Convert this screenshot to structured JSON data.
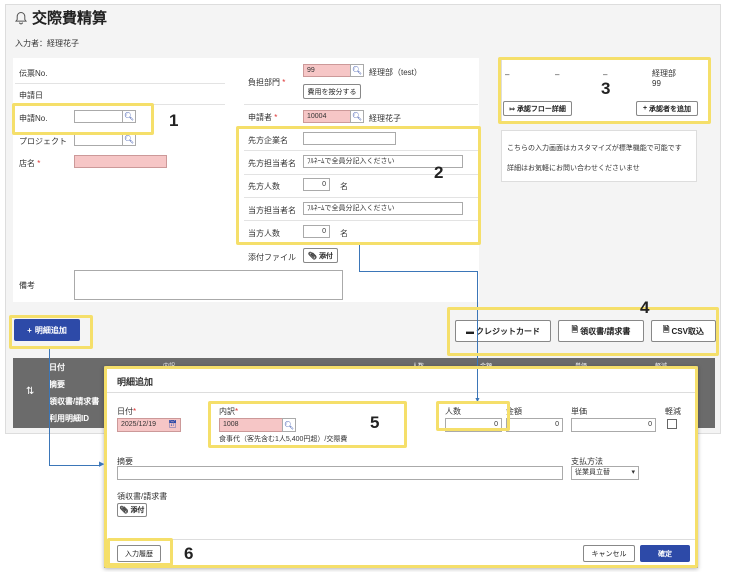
{
  "page": {
    "title": "交際費精算",
    "inputter": "入力者：経理花子"
  },
  "form": {
    "slip_no_label": "伝票No.",
    "apply_date_label": "申請日",
    "apply_no_label": "申請No.",
    "project_label": "プロジェクト",
    "store_label": "店名",
    "required_mark": "*",
    "dept_label": "負担部門",
    "dept_code": "99",
    "dept_name": "経理部（test）",
    "split_cost_button": "費用を按分する",
    "applicant_label": "申請者",
    "applicant_code": "10004",
    "applicant_name": "経理花子",
    "partner_company_label": "先方企業名",
    "partner_person_label": "先方担当者名",
    "partner_person_value": "ﾌﾙﾈｰﾑで全員分記入ください",
    "partner_count_label": "先方人数",
    "partner_count_value": "0",
    "our_person_label": "当方担当者名",
    "our_person_value": "ﾌﾙﾈｰﾑで全員分記入ください",
    "our_count_label": "当方人数",
    "our_count_value": "0",
    "count_unit": "名",
    "attach_label": "添付ファイル",
    "attach_button": "添付",
    "remarks_label": "備考"
  },
  "approval": {
    "dash1": "–",
    "dash2": "–",
    "dash3": "–",
    "dept": "経理部",
    "code": "99",
    "flow_button": "承認フロー詳細",
    "add_approver_button": "承認者を追加"
  },
  "note": {
    "line1": "こちらの入力画面はカスタマイズが標準機能で可能です",
    "line2": "詳細はお気軽にお問い合わせくださいませ"
  },
  "actions": {
    "add_detail": "明細追加",
    "credit_card": "クレジットカード",
    "receipt": "領収書/請求書",
    "csv": "CSV取込"
  },
  "table": {
    "col_date": "日付",
    "col_summary": "摘要",
    "col_receipt": "領収書/請求書",
    "col_usage_id": "利用明細ID",
    "col_breakdown": "内訳",
    "col_people": "人数",
    "col_amount": "金額",
    "col_unit": "単価",
    "col_reduced": "軽減"
  },
  "modal": {
    "title": "明細追加",
    "date_label": "日付",
    "date_value": "2025/12/19",
    "breakdown_label": "内訳",
    "breakdown_code": "1008",
    "breakdown_desc": "食事代（客先含む1人5,400円超）/交際費",
    "people_label": "人数",
    "people_value": "0",
    "amount_label": "金額",
    "amount_value": "0",
    "unit_label": "単価",
    "unit_value": "0",
    "reduced_label": "軽減",
    "summary_label": "摘要",
    "payment_label": "支払方法",
    "payment_value": "従業員立替",
    "receipt_label": "領収書/請求書",
    "attach_button": "添付",
    "history_button": "入力履歴",
    "cancel_button": "キャンセル",
    "confirm_button": "確定"
  },
  "callouts": [
    "1",
    "2",
    "3",
    "4",
    "5",
    "6"
  ],
  "colors": {
    "primary": "#2d4aa8",
    "highlight": "#f5df6a",
    "required_input": "#f6c6c6",
    "table_header": "#6b6b6b",
    "connector": "#3b76b8"
  }
}
